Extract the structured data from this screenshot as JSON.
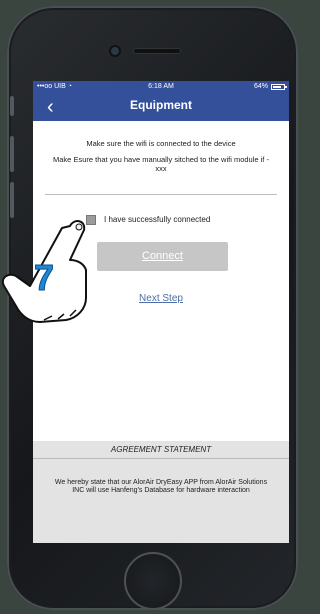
{
  "status_bar": {
    "carrier": "•••oo UIB ",
    "time": "6:18 AM",
    "battery_percent": "64%"
  },
  "header": {
    "back_icon": "chevron-left-icon",
    "back_glyph": "‹",
    "title": "Equipment"
  },
  "content": {
    "instruction_1": "Make sure the wifi is connected to the device",
    "instruction_2": "Make Esure that you have manually sitched to the wifi module if - xxx",
    "checkbox_label": "I have successfully connected",
    "checkbox_checked": false,
    "connect_button": "Connect",
    "next_step_link": "Next Step"
  },
  "agreement": {
    "title": "AGREEMENT STATEMENT",
    "text": "We hereby state that our AlorAir DryEasy APP from AlorAir Solutions INC will use Hanfeng's Database for hardware interaction"
  },
  "annotation": {
    "step_number": "7",
    "icon": "hand-pointer-icon",
    "accent_color": "#1e88d6"
  },
  "colors": {
    "header_bg": "#34509a",
    "button_disabled_bg": "#c6c6c6",
    "link": "#4d6ea8",
    "agreement_bg": "#e3e3e3",
    "background": "#3b4540"
  }
}
